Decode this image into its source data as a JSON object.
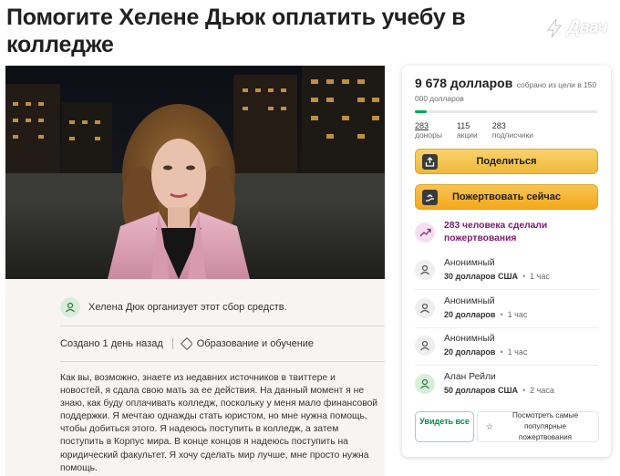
{
  "page": {
    "title": "Помогите Хелене Дьюк оплатить учебу в колледже",
    "watermark": "Двач"
  },
  "organizer": {
    "text": "Хелена Дюк организует этот сбор средств."
  },
  "meta": {
    "created": "Создано 1 день назад",
    "category": "Образование и обучение"
  },
  "story": "Как вы, возможно, знаете из недавних источников в твиттере и новостей, я сдала свою мать за ее действия. На данный момент я не знаю, как буду оплачивать колледж, поскольку у меня мало финансовой поддержки. Я мечтаю однажды стать юристом, но мне нужна помощь, чтобы добиться этого. Я надеюсь поступить в колледж, а затем поступить в Корпус мира. В конце концов я надеюсь поступить на юридический факультет. Я хочу сделать мир лучше, мне просто нужна помощь.",
  "card": {
    "raised_amount": "9 678 долларов",
    "goal_text": "собрано из цели в 150 000 долларов",
    "progress_fraction": 0.0645,
    "stats": [
      {
        "number": "283",
        "label": "доноры"
      },
      {
        "number": "115",
        "label": "акции"
      },
      {
        "number": "283",
        "label": "подписчики"
      }
    ],
    "share_label": "Поделиться",
    "donate_label": "Пожертвовать сейчас",
    "donors_count_text": "283 человека сделали пожертвования",
    "donations": [
      {
        "name": "Анонимный",
        "amount": "30 долларов США",
        "time": "1 час"
      },
      {
        "name": "Анонимный",
        "amount": "20 долларов",
        "time": "1 час"
      },
      {
        "name": "Анонимный",
        "amount": "20 долларов",
        "time": "1 час"
      },
      {
        "name": "Алан Рейли",
        "amount": "50 долларов США",
        "time": "2 часа"
      }
    ],
    "see_all_label": "Увидеть все",
    "top_donations_label": "Посмотреть самые популярные пожертвования"
  },
  "colors": {
    "accent_green": "#02a95c",
    "button_yellow": "#f0b83b",
    "donors_purple": "#7a1a72"
  }
}
